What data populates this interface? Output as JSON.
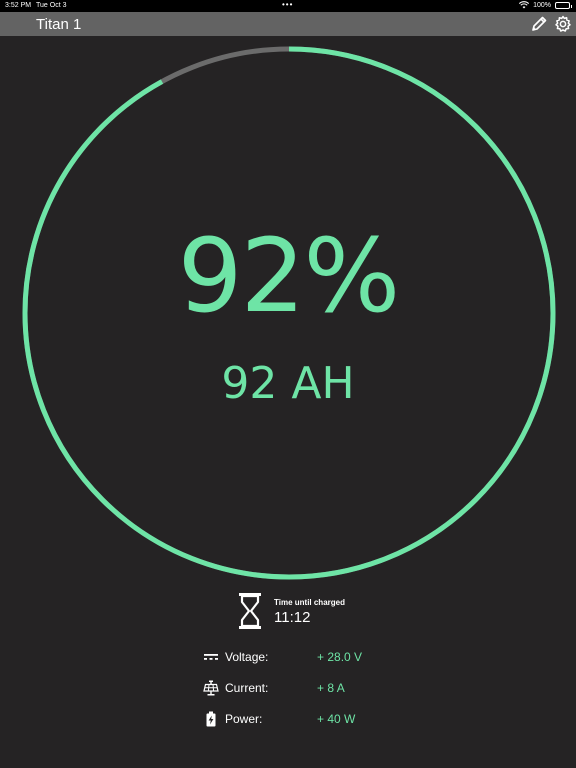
{
  "status_bar": {
    "time": "3:52 PM",
    "date": "Tue Oct 3",
    "battery": "100%"
  },
  "nav": {
    "title": "Titan 1",
    "edit_icon": "pencil-icon",
    "settings_icon": "gear-icon"
  },
  "gauge": {
    "level": 0.92,
    "percent_text": "92%",
    "amphours_text": "92 AH",
    "fill_color": "#6ee4a6",
    "track_color": "#6b6b6b"
  },
  "charge": {
    "label": "Time until charged",
    "value": "11:12",
    "icon": "hourglass-icon"
  },
  "stats": [
    {
      "label": "Voltage:",
      "value": "+ 28.0 V",
      "icon": "dc-voltage-icon"
    },
    {
      "label": "Current:",
      "value": "+ 8 A",
      "icon": "solar-panel-icon"
    },
    {
      "label": "Power:",
      "value": "+ 40 W",
      "icon": "battery-charging-icon"
    }
  ],
  "colors": {
    "background": "#252324",
    "nav_bar": "#636363",
    "accent": "#6ee4a6"
  }
}
